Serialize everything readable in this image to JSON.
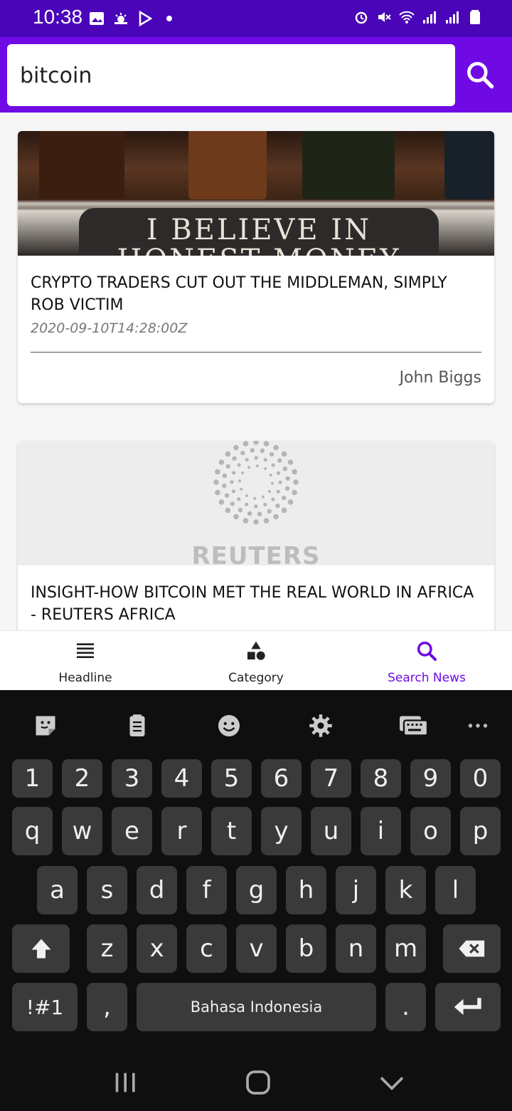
{
  "status_bar": {
    "time": "10:38",
    "left_icons": [
      "image-icon",
      "weather-icon",
      "play-store-icon",
      "dot-icon"
    ],
    "right_icons": [
      "alarm-icon",
      "mute-icon",
      "wifi-icon",
      "signal-icon",
      "signal-icon",
      "battery-icon"
    ]
  },
  "search": {
    "value": "bitcoin",
    "button_icon": "search-icon"
  },
  "articles": [
    {
      "image_text_line1": "I BELIEVE IN",
      "image_text_line2": "HONEST MONEY",
      "title": "CRYPTO TRADERS CUT OUT THE MIDDLEMAN, SIMPLY ROB VICTIM",
      "date": "2020-09-10T14:28:00Z",
      "author": "John Biggs"
    },
    {
      "image_logo_text": "REUTERS",
      "title": "INSIGHT-HOW BITCOIN MET THE REAL WORLD IN AFRICA - REUTERS AFRICA"
    }
  ],
  "bottom_nav": {
    "items": [
      {
        "label": "Headline",
        "icon": "list-icon"
      },
      {
        "label": "Category",
        "icon": "shapes-icon"
      },
      {
        "label": "Search News",
        "icon": "search-icon"
      }
    ],
    "active_color": "#6f0ae4"
  },
  "keyboard": {
    "toolbar": [
      "sticker-icon",
      "clipboard-icon",
      "emoji-icon",
      "settings-icon",
      "keyboard-icon",
      "more-icon"
    ],
    "row_numbers": [
      "1",
      "2",
      "3",
      "4",
      "5",
      "6",
      "7",
      "8",
      "9",
      "0"
    ],
    "row_1": [
      "q",
      "w",
      "e",
      "r",
      "t",
      "y",
      "u",
      "i",
      "o",
      "p"
    ],
    "row_2": [
      "a",
      "s",
      "d",
      "f",
      "g",
      "h",
      "j",
      "k",
      "l"
    ],
    "row_3": [
      "z",
      "x",
      "c",
      "v",
      "b",
      "n",
      "m"
    ],
    "symbols_key": "!#1",
    "comma_key": ",",
    "space_label": "Bahasa Indonesia",
    "period_key": "."
  },
  "colors": {
    "status_bar": "#4a05b8",
    "header": "#6f0ae4",
    "keyboard_bg": "#0f0f0f",
    "key_bg": "#3a3a3a"
  }
}
